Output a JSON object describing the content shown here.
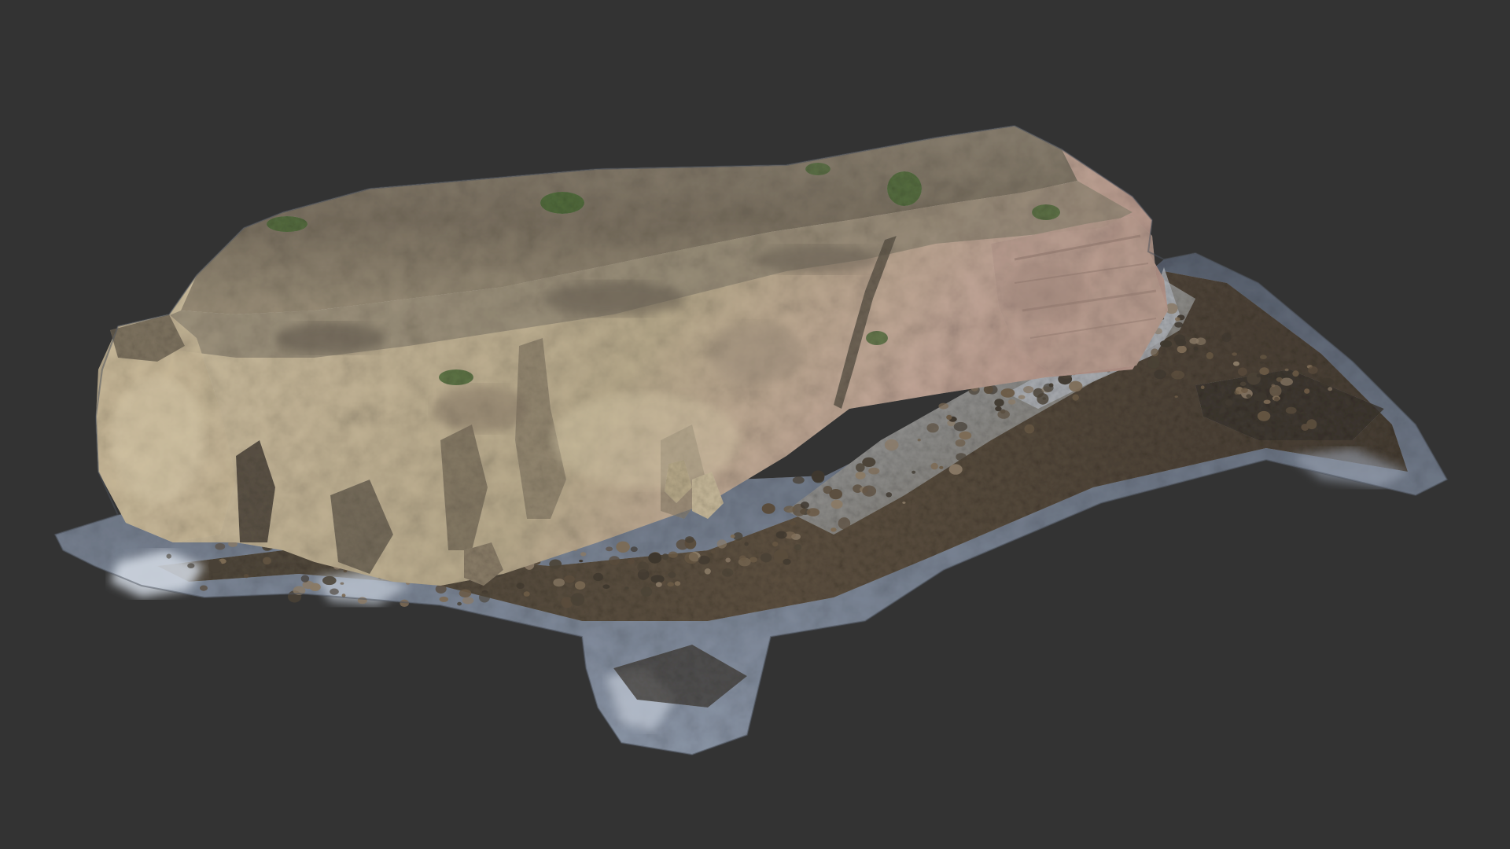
{
  "scene": {
    "background_color": "#333333",
    "subject": "photogrammetry-rock-scan",
    "palette": {
      "cliff_light": "#cbbd9c",
      "cliff_mid": "#a8987a",
      "cliff_shadow": "#6e6557",
      "cliff_pink": "#b89a8c",
      "top_grey": "#7d7464",
      "moss": "#4f6b3a",
      "beach_gravel": "#8e8f94",
      "beach_pale": "#b9bcc1",
      "rocks_dark": "#4a4236",
      "rocks_brown": "#6b5a45",
      "water_foam": "#c9d1dc",
      "water_edge": "#7c8796",
      "mesh_edge": "#5d6270"
    }
  }
}
